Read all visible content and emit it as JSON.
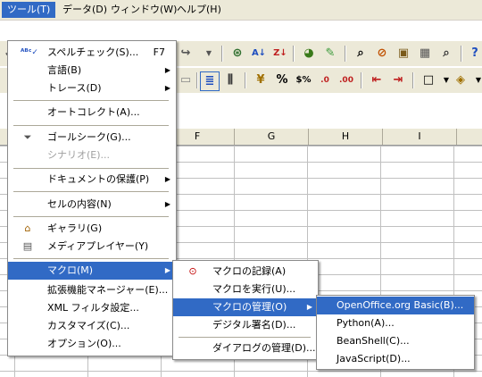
{
  "menubar": {
    "items": [
      "ツール(T)",
      "データ(D)",
      "ウィンドウ(W)",
      "ヘルプ(H)"
    ]
  },
  "tools_menu": {
    "items": [
      {
        "label": "スペルチェック(S)...",
        "shortcut": "F7",
        "icon": "spellcheck-icon"
      },
      {
        "label": "言語(B)",
        "submenu": true
      },
      {
        "label": "トレース(D)",
        "submenu": true
      },
      {
        "label": "オートコレクト(A)..."
      },
      {
        "label": "ゴールシーク(G)...",
        "icon": "goal-seek-icon"
      },
      {
        "label": "シナリオ(E)...",
        "disabled": true
      },
      {
        "label": "ドキュメントの保護(P)",
        "submenu": true
      },
      {
        "label": "セルの内容(N)",
        "submenu": true
      },
      {
        "label": "ギャラリ(G)",
        "icon": "gallery-icon"
      },
      {
        "label": "メディアプレイヤー(Y)",
        "icon": "media-player-icon"
      },
      {
        "label": "マクロ(M)",
        "submenu": true,
        "highlighted": true
      },
      {
        "label": "拡張機能マネージャー(E)..."
      },
      {
        "label": "XML フィルタ設定..."
      },
      {
        "label": "カスタマイズ(C)..."
      },
      {
        "label": "オプション(O)..."
      }
    ]
  },
  "macro_menu": {
    "items": [
      {
        "label": "マクロの記録(A)",
        "icon": "record-macro-icon"
      },
      {
        "label": "マクロを実行(U)..."
      },
      {
        "label": "マクロの管理(O)",
        "submenu": true,
        "highlighted": true
      },
      {
        "label": "デジタル署名(D)..."
      },
      {
        "label": "ダイアログの管理(D)..."
      }
    ]
  },
  "manage_menu": {
    "items": [
      {
        "label": "OpenOffice.org Basic(B)...",
        "highlighted": true
      },
      {
        "label": "Python(A)..."
      },
      {
        "label": "BeanShell(C)..."
      },
      {
        "label": "JavaScript(D)..."
      }
    ]
  },
  "sheet": {
    "columns": [
      "F",
      "G",
      "H",
      "I"
    ]
  },
  "colors": {
    "highlight": "#316ac5",
    "chrome": "#ece9d8"
  }
}
